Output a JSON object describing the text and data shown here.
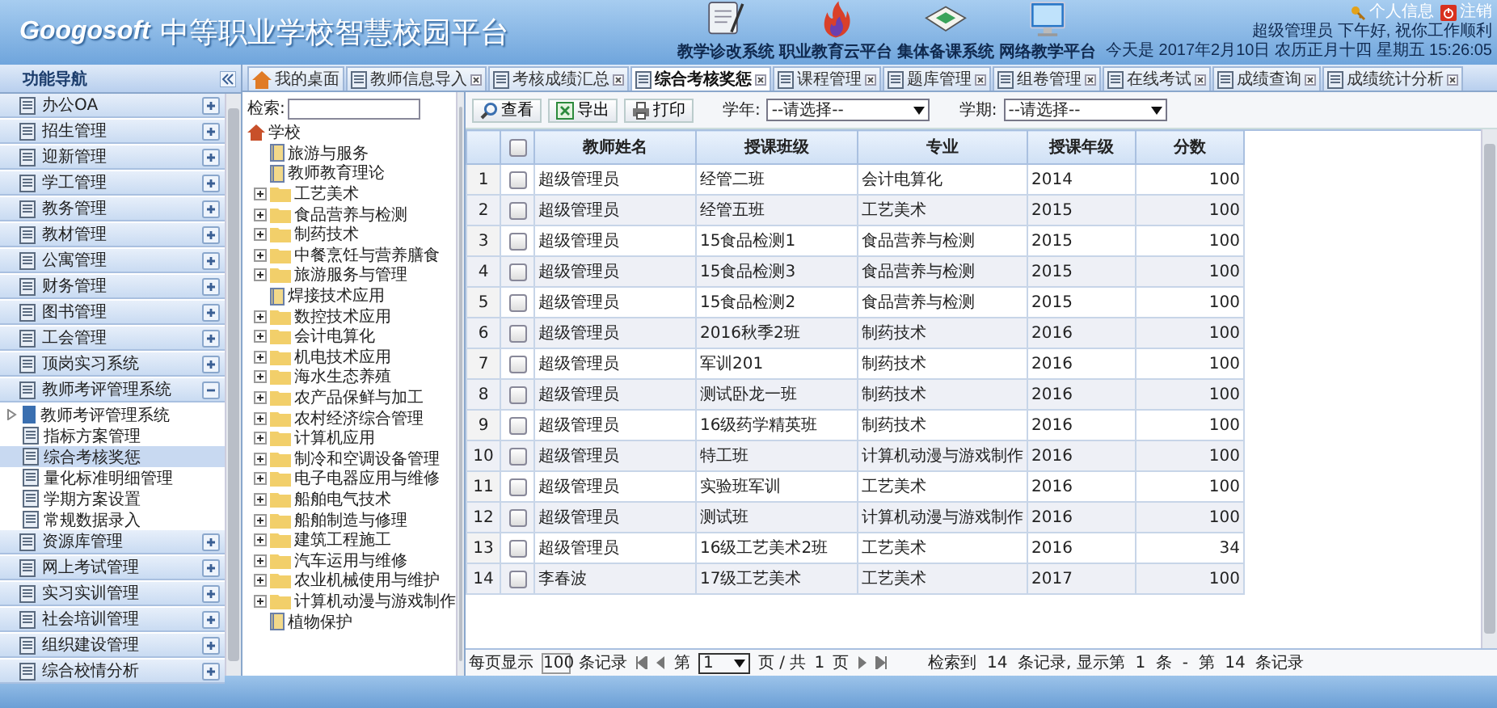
{
  "header": {
    "logo": "Googosoft",
    "title": "中等职业学校智慧校园平台",
    "systems": [
      {
        "label": "教学诊改系统"
      },
      {
        "label": "职业教育云平台"
      },
      {
        "label": "集体备课系统"
      },
      {
        "label": "网络教学平台"
      }
    ],
    "user_links": [
      {
        "label": "个人信息"
      },
      {
        "label": "注销"
      }
    ],
    "greeting": "超级管理员  下午好, 祝你工作顺利",
    "date": "今天是  2017年2月10日  农历正月十四  星期五  15:26:05"
  },
  "nav": {
    "title": "功能导航",
    "items": [
      {
        "label": "办公OA",
        "expanded": false
      },
      {
        "label": "招生管理",
        "expanded": false
      },
      {
        "label": "迎新管理",
        "expanded": false
      },
      {
        "label": "学工管理",
        "expanded": false
      },
      {
        "label": "教务管理",
        "expanded": false
      },
      {
        "label": "教材管理",
        "expanded": false
      },
      {
        "label": "公寓管理",
        "expanded": false
      },
      {
        "label": "财务管理",
        "expanded": false
      },
      {
        "label": "图书管理",
        "expanded": false
      },
      {
        "label": "工会管理",
        "expanded": false
      },
      {
        "label": "顶岗实习系统",
        "expanded": false
      },
      {
        "label": "教师考评管理系统",
        "expanded": true,
        "children": [
          {
            "label": "教师考评管理系统",
            "kind": "system",
            "selected": false
          },
          {
            "label": "指标方案管理",
            "kind": "page",
            "selected": false
          },
          {
            "label": "综合考核奖惩",
            "kind": "page",
            "selected": true
          },
          {
            "label": "量化标准明细管理",
            "kind": "page",
            "selected": false
          },
          {
            "label": "学期方案设置",
            "kind": "page",
            "selected": false
          },
          {
            "label": "常规数据录入",
            "kind": "page",
            "selected": false
          }
        ]
      },
      {
        "label": "资源库管理",
        "expanded": false
      },
      {
        "label": "网上考试管理",
        "expanded": false
      },
      {
        "label": "实习实训管理",
        "expanded": false
      },
      {
        "label": "社会培训管理",
        "expanded": false
      },
      {
        "label": "组织建设管理",
        "expanded": false
      },
      {
        "label": "综合校情分析",
        "expanded": false
      }
    ]
  },
  "tabs": [
    {
      "label": "我的桌面",
      "selected": false,
      "kind": "home"
    },
    {
      "label": "教师信息导入",
      "selected": false,
      "kind": "page"
    },
    {
      "label": "考核成绩汇总",
      "selected": false,
      "kind": "page"
    },
    {
      "label": "综合考核奖惩",
      "selected": true,
      "kind": "page"
    },
    {
      "label": "课程管理",
      "selected": false,
      "kind": "page"
    },
    {
      "label": "题库管理",
      "selected": false,
      "kind": "page"
    },
    {
      "label": "组卷管理",
      "selected": false,
      "kind": "page"
    },
    {
      "label": "在线考试",
      "selected": false,
      "kind": "page"
    },
    {
      "label": "成绩查询",
      "selected": false,
      "kind": "page"
    },
    {
      "label": "成绩统计分析",
      "selected": false,
      "kind": "page"
    }
  ],
  "tree": {
    "search_label": "检索:",
    "root": {
      "label": "学校",
      "expanded": true,
      "children": [
        {
          "label": "旅游与服务",
          "kind": "leaf"
        },
        {
          "label": "教师教育理论",
          "kind": "leaf"
        },
        {
          "label": "工艺美术",
          "kind": "folder",
          "expanded": false
        },
        {
          "label": "食品营养与检测",
          "kind": "folder",
          "expanded": false
        },
        {
          "label": "制药技术",
          "kind": "folder",
          "expanded": false
        },
        {
          "label": "中餐烹饪与营养膳食",
          "kind": "folder",
          "expanded": false
        },
        {
          "label": "旅游服务与管理",
          "kind": "folder",
          "expanded": false
        },
        {
          "label": "焊接技术应用",
          "kind": "leaf"
        },
        {
          "label": "数控技术应用",
          "kind": "folder",
          "expanded": false
        },
        {
          "label": "会计电算化",
          "kind": "folder",
          "expanded": false
        },
        {
          "label": "机电技术应用",
          "kind": "folder",
          "expanded": false
        },
        {
          "label": "海水生态养殖",
          "kind": "folder",
          "expanded": false
        },
        {
          "label": "农产品保鲜与加工",
          "kind": "folder",
          "expanded": false
        },
        {
          "label": "农村经济综合管理",
          "kind": "folder",
          "expanded": false
        },
        {
          "label": "计算机应用",
          "kind": "folder",
          "expanded": false
        },
        {
          "label": "制冷和空调设备管理",
          "kind": "folder",
          "expanded": false
        },
        {
          "label": "电子电器应用与维修",
          "kind": "folder",
          "expanded": false
        },
        {
          "label": "船舶电气技术",
          "kind": "folder",
          "expanded": false
        },
        {
          "label": "船舶制造与修理",
          "kind": "folder",
          "expanded": false
        },
        {
          "label": "建筑工程施工",
          "kind": "folder",
          "expanded": false
        },
        {
          "label": "汽车运用与维修",
          "kind": "folder",
          "expanded": false
        },
        {
          "label": "农业机械使用与维护",
          "kind": "folder",
          "expanded": false
        },
        {
          "label": "计算机动漫与游戏制作",
          "kind": "folder",
          "expanded": false
        },
        {
          "label": "植物保护",
          "kind": "leaf"
        }
      ]
    }
  },
  "toolbar": {
    "buttons": [
      {
        "label": "查看"
      },
      {
        "label": "导出"
      },
      {
        "label": "打印"
      }
    ],
    "filters": [
      {
        "label": "学年:",
        "value": "--请选择--"
      },
      {
        "label": "学期:",
        "value": "--请选择--"
      }
    ]
  },
  "table": {
    "columns": [
      "教师姓名",
      "授课班级",
      "专业",
      "授课年级",
      "分数"
    ],
    "all_checked": false,
    "rows": [
      {
        "index": "1",
        "checked": false,
        "cells": [
          "超级管理员",
          "经管二班",
          "会计电算化",
          "2014",
          "100"
        ]
      },
      {
        "index": "2",
        "checked": false,
        "cells": [
          "超级管理员",
          "经管五班",
          "工艺美术",
          "2015",
          "100"
        ]
      },
      {
        "index": "3",
        "checked": false,
        "cells": [
          "超级管理员",
          "15食品检测1",
          "食品营养与检测",
          "2015",
          "100"
        ]
      },
      {
        "index": "4",
        "checked": false,
        "cells": [
          "超级管理员",
          "15食品检测3",
          "食品营养与检测",
          "2015",
          "100"
        ]
      },
      {
        "index": "5",
        "checked": false,
        "cells": [
          "超级管理员",
          "15食品检测2",
          "食品营养与检测",
          "2015",
          "100"
        ]
      },
      {
        "index": "6",
        "checked": false,
        "cells": [
          "超级管理员",
          "2016秋季2班",
          "制药技术",
          "2016",
          "100"
        ]
      },
      {
        "index": "7",
        "checked": false,
        "cells": [
          "超级管理员",
          "军训201",
          "制药技术",
          "2016",
          "100"
        ]
      },
      {
        "index": "8",
        "checked": false,
        "cells": [
          "超级管理员",
          "测试卧龙一班",
          "制药技术",
          "2016",
          "100"
        ]
      },
      {
        "index": "9",
        "checked": false,
        "cells": [
          "超级管理员",
          "16级药学精英班",
          "制药技术",
          "2016",
          "100"
        ]
      },
      {
        "index": "10",
        "checked": false,
        "cells": [
          "超级管理员",
          "特工班",
          "计算机动漫与游戏制作",
          "2016",
          "100"
        ]
      },
      {
        "index": "11",
        "checked": false,
        "cells": [
          "超级管理员",
          "实验班军训",
          "工艺美术",
          "2016",
          "100"
        ]
      },
      {
        "index": "12",
        "checked": false,
        "cells": [
          "超级管理员",
          "测试班",
          "计算机动漫与游戏制作",
          "2016",
          "100"
        ]
      },
      {
        "index": "13",
        "checked": false,
        "cells": [
          "超级管理员",
          "16级工艺美术2班",
          "工艺美术",
          "2016",
          "34"
        ]
      },
      {
        "index": "14",
        "checked": false,
        "cells": [
          "李春波",
          "17级工艺美术",
          "工艺美术",
          "2017",
          "100"
        ]
      }
    ]
  },
  "pager": {
    "page_size_label": "每页显示",
    "page_size": "100",
    "records_label": "条记录",
    "page_label": "第",
    "page": "1",
    "of_label": "页 / 共",
    "total_pages": "1",
    "pages_label": "页",
    "summary": "检索到  14  条记录, 显示第  1  条  -  第  14  条记录"
  }
}
